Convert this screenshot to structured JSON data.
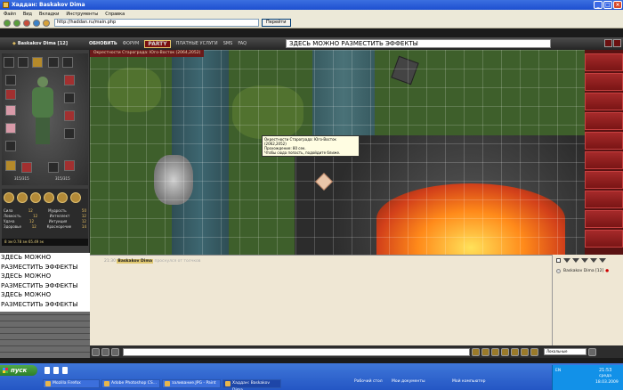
{
  "window": {
    "title": "Хаддан: Baskakov Dima"
  },
  "menu": [
    "Файл",
    "Вид",
    "Вкладки",
    "Инструменты",
    "Справка"
  ],
  "browser": {
    "address": "http://haddan.ru/main.php",
    "go_label": "Перейти"
  },
  "game": {
    "user": "Baskakov Dima [12]",
    "nav": [
      "ОБНОВИТЬ",
      "ФОРУМ",
      "ПЛАТНЫЕ УСЛУГИ",
      "SMS",
      "FAQ"
    ],
    "party_logo": "PARTY",
    "effects_input": "ЗДЕСЬ МОЖНО РАЗМЕСТИТЬ ЭФФЕКТЫ",
    "map_title": "Окрестности Старограда: Юго-Восток (2064,2052)",
    "tooltip": "Окрестности Старограда: Юго-Восток (2062,2052)\nПрохождение: 80 сек.\nЧтобы сюда попасть, подойдите ближе."
  },
  "character": {
    "coords": [
      "315/315",
      "315/315"
    ],
    "stats": [
      {
        "k": "Сила",
        "v": "12",
        "k2": "Мудрость",
        "v2": "50"
      },
      {
        "k": "Ловкость",
        "v": "12",
        "k2": "Интеллект",
        "v2": "12"
      },
      {
        "k": "Удача",
        "v": "12",
        "k2": "Интуиция",
        "v2": "12"
      },
      {
        "k": "Здоровье",
        "v": "12",
        "k2": "Красноречие",
        "v2": "14"
      }
    ],
    "money": "8 зм  0.78 зм  65.49 эк"
  },
  "effects_box": "ЗДЕСЬ МОЖНО РАЗМЕСТИТЬ ЭФФЕКТЫ ЗДЕСЬ МОЖНО РАЗМЕСТИТЬ ЭФФЕКТЫ ЗДЕСЬ МОЖНО РАЗМЕСТИТЬ ЭФФЕКТЫ",
  "chat": {
    "time": "21:30",
    "nick": "Baskakov Dima",
    "message": "проснулся от толчков"
  },
  "online": {
    "user": "Baskakov Dima [12]"
  },
  "chatbar": {
    "select_value": "Локальные"
  },
  "taskbar": {
    "start": "пуск",
    "items": [
      "Mozilla Firefox",
      "Adobe Photoshop CS...",
      "заливание.JPG - Paint",
      "Хаддан: Baskakov Dima"
    ],
    "desktop": "Рабочий стол",
    "my_docs": "Мои документы",
    "my_computer": "Мой компьютер",
    "lang": "EN",
    "time": "21:53",
    "day": "среда",
    "date": "18.03.2009"
  },
  "colors": {
    "accent": "#6a1a1a",
    "taskbar": "#2456c4"
  }
}
